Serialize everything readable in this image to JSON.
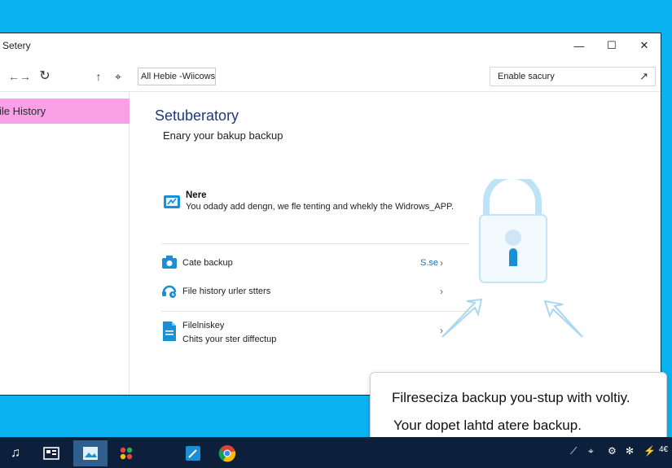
{
  "window": {
    "title": "Setery",
    "controls": {
      "minimize": "—",
      "maximize": "☐",
      "close": "✕"
    }
  },
  "toolbar": {
    "back": "←",
    "forward": "→",
    "refresh": "↻",
    "up": "↑",
    "pin": "⌖",
    "address": "All Hebie -Wiicows",
    "search_placeholder": "Enable sacury",
    "search_go": "↗"
  },
  "sidebar": {
    "items": [
      {
        "label": "ile History",
        "selected": true
      }
    ]
  },
  "main": {
    "title": "Setuberatory",
    "subtitle": "Enary your bakup backup",
    "note": {
      "title": "Nere",
      "text": "You odady add dengn, we fle tenting and whekly the Widrows_APP."
    },
    "rows": [
      {
        "label": "Cate backup",
        "action": "S.se",
        "chevron": "›"
      },
      {
        "label": "File history urler stters",
        "chevron": "›"
      },
      {
        "label": "Filelniskey",
        "desc": "Chits your ster diffectup",
        "chevron": "›"
      }
    ]
  },
  "popup": {
    "line1": "Filreseciza backup you-stup with voltiy.",
    "line2": "Your dopet lahtd atere backup."
  },
  "taskbar": {
    "apps": [
      "music-app",
      "calendar-app",
      "photos-app",
      "games-app",
      "pen-app",
      "chrome-app"
    ],
    "tray_time": "4€"
  },
  "colors": {
    "desktop": "#0bb2f0",
    "selection": "#f9a0e6",
    "accent": "#1a8fd6",
    "taskbar": "#0c1f3b",
    "title_blue": "#1f3a78"
  }
}
